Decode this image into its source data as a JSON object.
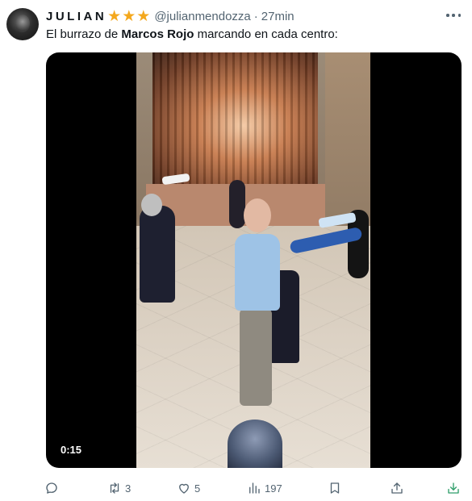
{
  "tweet": {
    "author": {
      "display_name": "JULIAN",
      "badges": [
        "star-icon",
        "star-icon",
        "star-icon"
      ],
      "handle": "@julianmendozza",
      "separator": "·",
      "timestamp": "27min"
    },
    "text": {
      "part1": "El burrazo de ",
      "bold": "Marcos Rojo",
      "part2": " marcando en cada centro:"
    },
    "media": {
      "type": "video",
      "duration": "0:15"
    },
    "actions": {
      "reply": {
        "icon": "reply-icon",
        "count": ""
      },
      "retweet": {
        "icon": "retweet-icon",
        "count": "3"
      },
      "like": {
        "icon": "heart-icon",
        "count": "5"
      },
      "views": {
        "icon": "views-icon",
        "count": "197"
      },
      "bookmark": {
        "icon": "bookmark-icon"
      },
      "share": {
        "icon": "share-icon"
      },
      "download": {
        "icon": "download-icon",
        "color": "#2f9e6a"
      }
    },
    "colors": {
      "star": "#f4a81d",
      "secondary_text": "#536471",
      "primary_text": "#0f1419"
    }
  }
}
